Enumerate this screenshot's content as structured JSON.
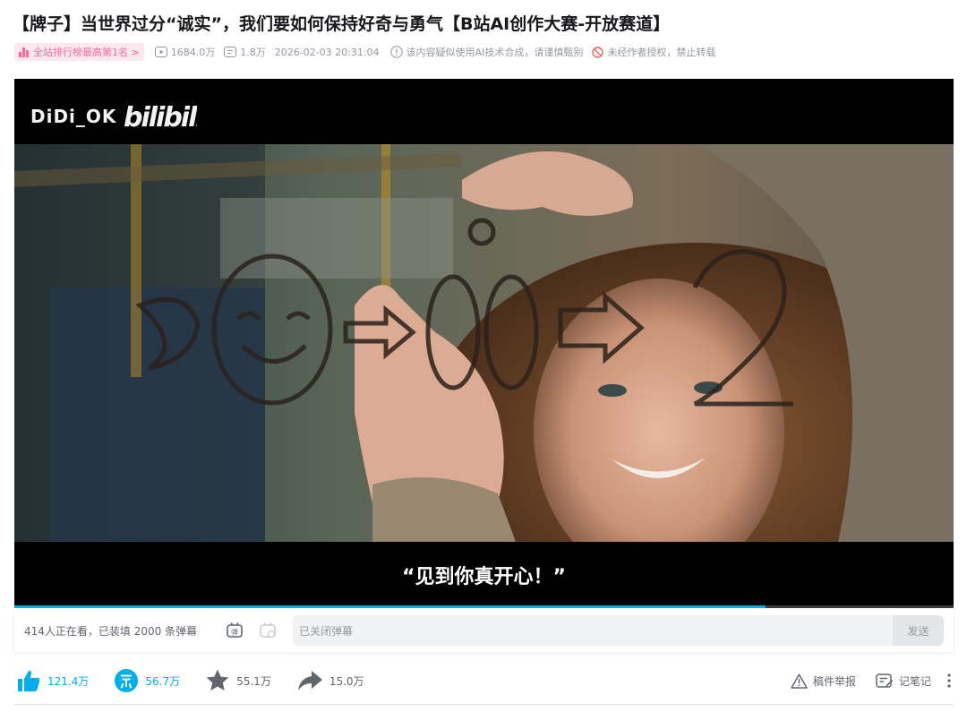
{
  "video": {
    "title": "【牌子】当世界过分“诚实”，我们要如何保持好奇与勇气【B站AI创作大赛-开放赛道】",
    "rank_badge": "全站排行榜最高第1名 >",
    "plays": "1684.0万",
    "danmaku_count": "1.8万",
    "publish_time": "2026-02-03 20:31:04",
    "ai_notice": "该内容疑似使用AI技术合成，请谨慎甄别",
    "repost_notice": "未经作者授权，禁止转载"
  },
  "player": {
    "watermark_user": "DiDi_OK",
    "watermark_logo": "bilibili",
    "subtitle": "“见到你真开心！”",
    "progress": 0.8
  },
  "danmaku_bar": {
    "viewers_text": "414人正在看，已装填 2000 条弹幕",
    "input_placeholder": "已关闭弹幕",
    "send_label": "发送"
  },
  "actions": {
    "like": "121.4万",
    "coin": "56.7万",
    "favorite": "55.1万",
    "share": "15.0万",
    "report": "稿件举报",
    "notes": "记笔记"
  },
  "colors": {
    "accent_blue": "#00aeec",
    "rank_pink": "#ff6699",
    "muted": "#9499a0",
    "ban_red": "#f25d59"
  },
  "icons": {
    "plays": "play-icon",
    "danmaku": "danmaku-icon",
    "ai": "info-circle-icon",
    "ban": "forbidden-icon",
    "like": "thumbs-up-icon",
    "coin": "coin-icon",
    "favorite": "star-icon",
    "share": "share-arrow-icon",
    "report": "warning-icon",
    "notes": "notes-icon",
    "more": "more-vertical-icon"
  }
}
